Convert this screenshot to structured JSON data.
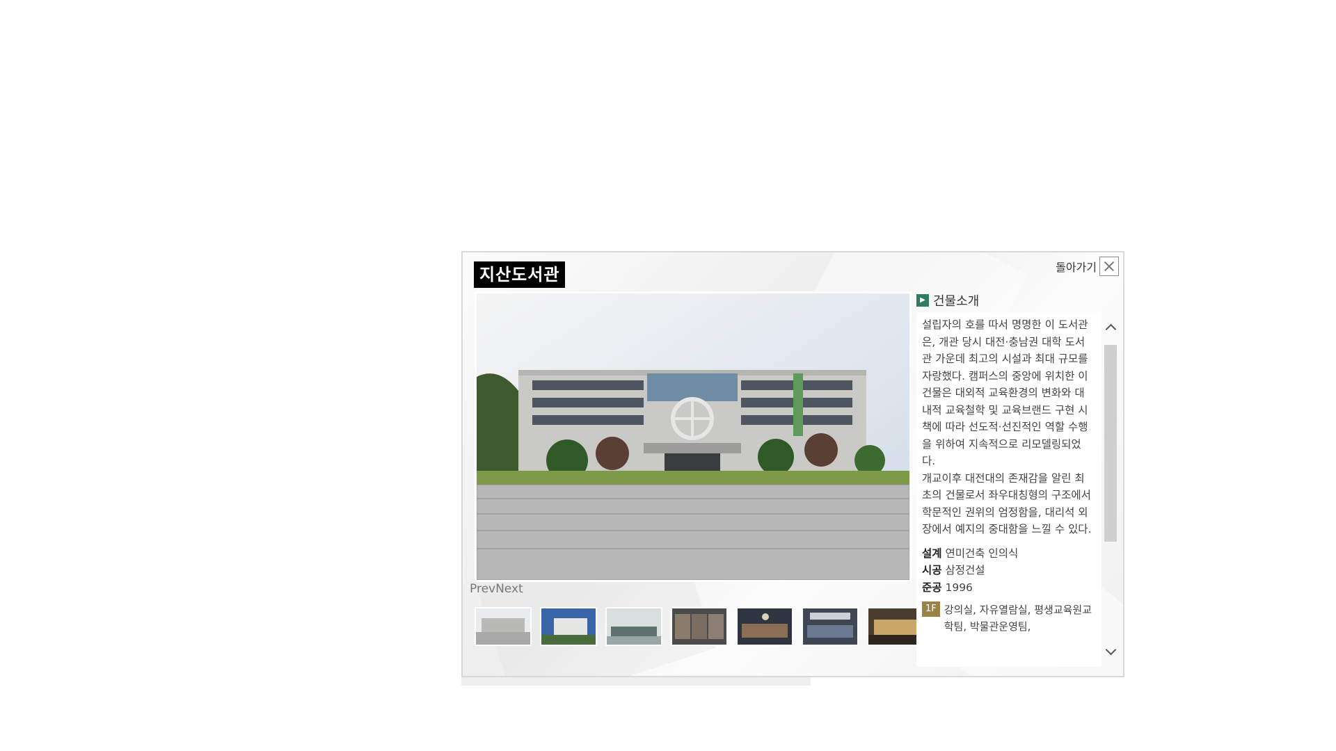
{
  "modal": {
    "title": "지산도서관",
    "back_label": "돌아가기",
    "close_icon": "close-icon"
  },
  "gallery": {
    "prev_label": "Prev",
    "next_label": "Next",
    "thumb_count": 7
  },
  "info": {
    "section_title": "건물소개",
    "description": [
      "설립자의 호를 따서 명명한 이 도서관은, 개관 당시 대전·충남권 대학 도서관 가운데 최고의 시설과 최대 규모를 자랑했다. 캠퍼스의 중앙에 위치한 이 건물은 대외적 교육환경의 변화와 대내적 교육철학 및 교육브랜드 구현 시책에 따라 선도적·선진적인 역할 수행을 위하여 지속적으로 리모델링되었다.",
      "개교이후 대전대의 존재감을 알린 최초의 건물로서 좌우대칭형의 구조에서 학문적인 권위의 엄정함을, 대리석 외장에서 예지의 중대함을 느낄 수 있다."
    ],
    "design_label": "설계",
    "design_value": "연미건축 인의식",
    "construction_label": "시공",
    "construction_value": "삼정건설",
    "completion_label": "준공",
    "completion_value": "1996",
    "floor_badge": "1F",
    "floor_text": "강의실, 자유열람실, 평생교육원교학팀, 박물관운영팀,"
  },
  "colors": {
    "title_bg": "#000000",
    "section_icon": "#2f7d5a",
    "floor_badge": "#9a8347",
    "scroll_thumb": "#cfcfcf"
  }
}
